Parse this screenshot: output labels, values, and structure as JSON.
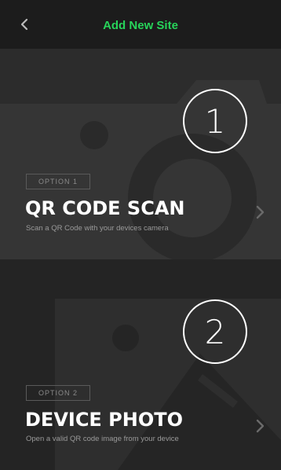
{
  "header": {
    "title": "Add New Site",
    "back_icon": "chevron-left-icon",
    "title_color": "#27d45a"
  },
  "options": [
    {
      "step_number": "1",
      "badge": "OPTION 1",
      "title": "QR CODE SCAN",
      "subtitle": "Scan a QR Code with your devices camera",
      "background_icon": "camera-icon",
      "action_icon": "chevron-right-icon"
    },
    {
      "step_number": "2",
      "badge": "OPTION 2",
      "title": "DEVICE PHOTO",
      "subtitle": "Open a valid QR code image from your device",
      "background_icon": "image-icon",
      "action_icon": "chevron-right-icon"
    }
  ]
}
